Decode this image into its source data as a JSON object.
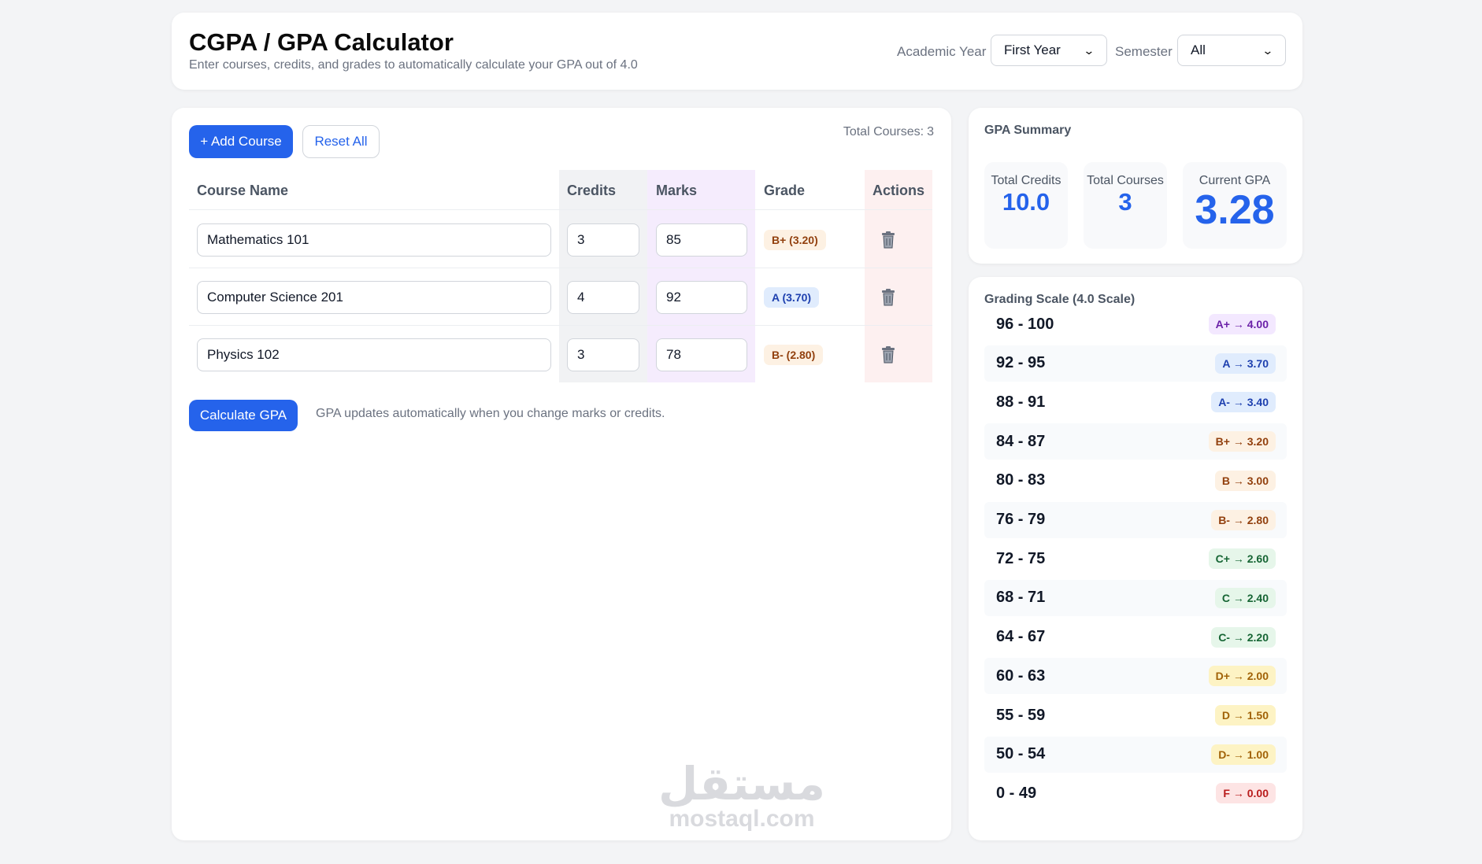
{
  "header": {
    "title": "CGPA / GPA Calculator",
    "subtitle": "Enter courses, credits, and grades to automatically calculate your GPA out of 4.0",
    "academic_year_label": "Academic Year",
    "academic_year_value": "First Year",
    "semester_label": "Semester",
    "semester_value": "All"
  },
  "toolbar": {
    "add_label": "+ Add Course",
    "reset_label": "Reset All",
    "total_courses_label": "Total Courses:",
    "total_courses_value": "3"
  },
  "table": {
    "headers": [
      "Course Name",
      "Credits",
      "Marks",
      "Grade",
      "Actions"
    ],
    "rows": [
      {
        "name": "Mathematics 101",
        "credits": "3",
        "marks": "85",
        "grade": "B+ (3.20)",
        "grade_color": "#92400e",
        "grade_bg": "#fdf1e3"
      },
      {
        "name": "Computer Science 201",
        "credits": "4",
        "marks": "92",
        "grade": "A (3.70)",
        "grade_color": "#1e40af",
        "grade_bg": "#e0ecfd"
      },
      {
        "name": "Physics 102",
        "credits": "3",
        "marks": "78",
        "grade": "B- (2.80)",
        "grade_color": "#92400e",
        "grade_bg": "#fdf1e3"
      }
    ]
  },
  "footer": {
    "calculate_label": "Calculate GPA",
    "hint": "GPA updates automatically when you change marks or credits."
  },
  "summary": {
    "title": "GPA Summary",
    "total_credits_label": "Total Credits",
    "total_credits_value": "10.0",
    "total_courses_label": "Total Courses",
    "total_courses_value": "3",
    "current_gpa_label": "Current GPA",
    "current_gpa_value": "3.28"
  },
  "scale": {
    "title": "Grading Scale (4.0 Scale)",
    "rows": [
      {
        "range": "96 - 100",
        "grade": "A+ → 4.00",
        "color": "#6b21a8",
        "bg": "#f3e8ff"
      },
      {
        "range": "92 - 95",
        "grade": "A → 3.70",
        "color": "#1e40af",
        "bg": "#e0ecfd"
      },
      {
        "range": "88 - 91",
        "grade": "A- → 3.40",
        "color": "#1e40af",
        "bg": "#e0ecfd"
      },
      {
        "range": "84 - 87",
        "grade": "B+ → 3.20",
        "color": "#92400e",
        "bg": "#fdf1e3"
      },
      {
        "range": "80 - 83",
        "grade": "B → 3.00",
        "color": "#92400e",
        "bg": "#fdf1e3"
      },
      {
        "range": "76 - 79",
        "grade": "B- → 2.80",
        "color": "#92400e",
        "bg": "#fdf1e3"
      },
      {
        "range": "72 - 75",
        "grade": "C+ → 2.60",
        "color": "#166534",
        "bg": "#e6f6ea"
      },
      {
        "range": "68 - 71",
        "grade": "C → 2.40",
        "color": "#166534",
        "bg": "#e6f6ea"
      },
      {
        "range": "64 - 67",
        "grade": "C- → 2.20",
        "color": "#166534",
        "bg": "#e6f6ea"
      },
      {
        "range": "60 - 63",
        "grade": "D+ → 2.00",
        "color": "#a16207",
        "bg": "#fdf3c4"
      },
      {
        "range": "55 - 59",
        "grade": "D → 1.50",
        "color": "#a16207",
        "bg": "#fdf3c4"
      },
      {
        "range": "50 - 54",
        "grade": "D- → 1.00",
        "color": "#a16207",
        "bg": "#fdf3c4"
      },
      {
        "range": "0 - 49",
        "grade": "F → 0.00",
        "color": "#b91c1c",
        "bg": "#fde4e4"
      }
    ]
  },
  "watermark": {
    "arabic": "مستقل",
    "latin": "mostaql.com"
  },
  "colors": {
    "accent": "#2563eb",
    "credits_col": "#f1f2f4",
    "marks_col": "#f5ecfd",
    "actions_col": "#fdf0f0"
  },
  "icons": {
    "delete": "trash-icon",
    "select": "chevron-down-icon"
  }
}
